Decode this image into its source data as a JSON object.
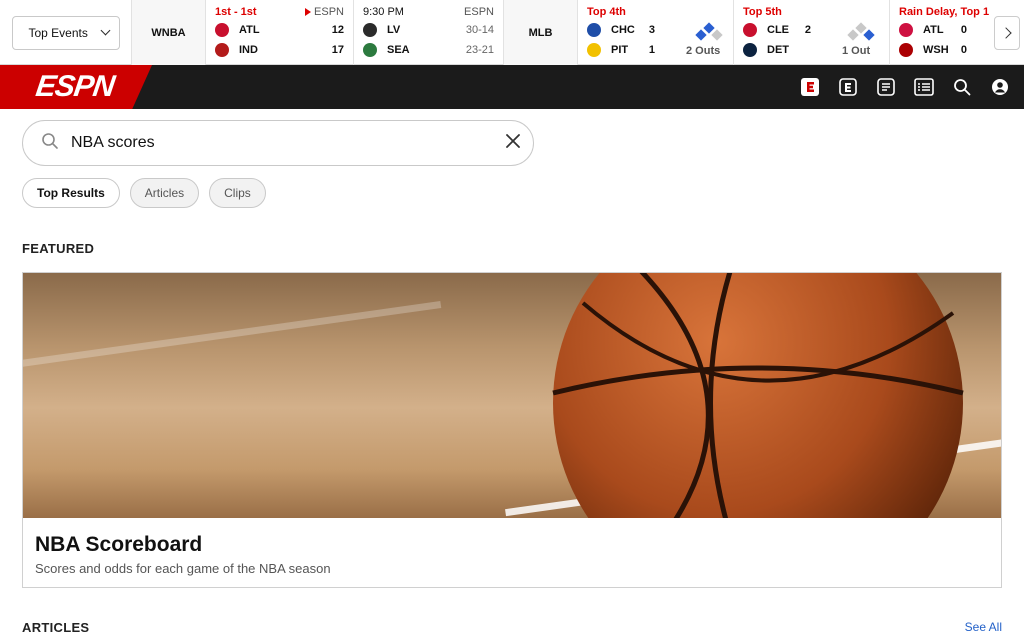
{
  "scorestrip": {
    "events_select": "Top Events",
    "league_wnba": "WNBA",
    "league_mlb": "MLB",
    "games": [
      {
        "status": "1st - 1st",
        "network": "ESPN",
        "teams": [
          {
            "abbr": "ATL",
            "score": "12"
          },
          {
            "abbr": "IND",
            "score": "17"
          }
        ]
      },
      {
        "status": "9:30 PM",
        "network": "ESPN",
        "teams": [
          {
            "abbr": "LV",
            "record": "30-14"
          },
          {
            "abbr": "SEA",
            "record": "23-21"
          }
        ]
      },
      {
        "status": "Top 4th",
        "teams": [
          {
            "abbr": "CHC",
            "score": "3"
          },
          {
            "abbr": "PIT",
            "score": "1"
          }
        ],
        "outs": "2 Outs"
      },
      {
        "status": "Top 5th",
        "teams": [
          {
            "abbr": "CLE",
            "score": "2"
          },
          {
            "abbr": "DET",
            "score": ""
          }
        ],
        "outs": "1 Out"
      },
      {
        "status": "Rain Delay, Top 1",
        "teams": [
          {
            "abbr": "ATL",
            "score": "0"
          },
          {
            "abbr": "WSH",
            "score": "0"
          }
        ]
      }
    ]
  },
  "navbar": {
    "brand": "ESPN"
  },
  "search": {
    "value": "NBA scores"
  },
  "filters": [
    "Top Results",
    "Articles",
    "Clips"
  ],
  "featured": {
    "label": "FEATURED",
    "title": "NBA Scoreboard",
    "subtitle": "Scores and odds for each game of the NBA season"
  },
  "articles": {
    "label": "ARTICLES",
    "see_all": "See All"
  },
  "colors": {
    "espn_red": "#cc0000",
    "navbar_bg": "#1b1b1b",
    "live_red": "#dd0000",
    "link_blue": "#2361c8"
  }
}
